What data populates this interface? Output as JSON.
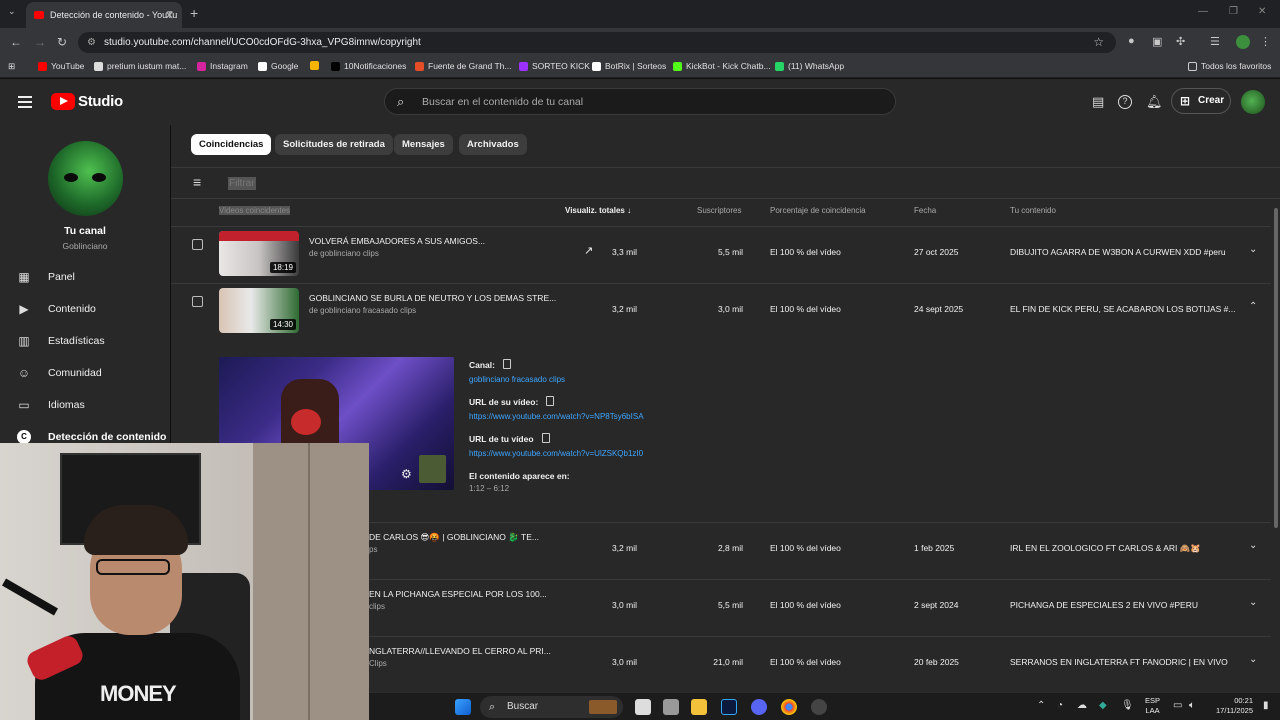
{
  "browser": {
    "tab_title": "Detección de contenido - YouTu",
    "url": "studio.youtube.com/channel/UCO0cdOFdG-3hxa_VPG8imnw/copyright",
    "bookmarks": [
      {
        "label": "YouTube",
        "color": "#ff0000"
      },
      {
        "label": "pretium iustum mat...",
        "color": "#dddddd"
      },
      {
        "label": "Instagram",
        "color": "#d6249f"
      },
      {
        "label": "Google",
        "color": "#ffffff"
      },
      {
        "label": "",
        "color": "#f4b400"
      },
      {
        "label": "10Notificaciones",
        "color": "#000000"
      },
      {
        "label": "Fuente de Grand Th...",
        "color": "#e44d26"
      },
      {
        "label": "SORTEO KICK",
        "color": "#9b30ff"
      },
      {
        "label": "BotRix | Sorteos",
        "color": "#ffffff"
      },
      {
        "label": "KickBot - Kick Chatb...",
        "color": "#53fc18"
      },
      {
        "label": "(11) WhatsApp",
        "color": "#25d366"
      }
    ],
    "all_bookmarks": "Todos los favoritos"
  },
  "header": {
    "logo_text": "Studio",
    "search_placeholder": "Buscar en el contenido de tu canal",
    "create_label": "Crear"
  },
  "sidebar": {
    "channel_title": "Tu canal",
    "channel_name": "Goblinciano",
    "items": [
      {
        "label": "Panel",
        "icon": "dashboard-icon"
      },
      {
        "label": "Contenido",
        "icon": "content-icon"
      },
      {
        "label": "Estadísticas",
        "icon": "analytics-icon"
      },
      {
        "label": "Comunidad",
        "icon": "community-icon"
      },
      {
        "label": "Idiomas",
        "icon": "subtitles-icon"
      },
      {
        "label": "Detección de contenido",
        "icon": "copyright-icon",
        "active": true
      }
    ]
  },
  "tabs": [
    "Coincidencias",
    "Solicitudes de retirada",
    "Mensajes",
    "Archivados"
  ],
  "filter_label": "Filtrar",
  "columns": {
    "videos": "Videos coincidentes",
    "views": "Visualiz. totales",
    "subs": "Suscriptores",
    "match": "Porcentaje de coincidencia",
    "date": "Fecha",
    "yours": "Tu contenido"
  },
  "rows": [
    {
      "title": "VOLVERÁ EMBAJADORES A SUS AMIGOS...",
      "channel": "de goblinciano clips",
      "duration": "18:19",
      "views": "3,3 mil",
      "subs": "5,5 mil",
      "match": "El 100 % del vídeo",
      "date": "27 oct 2025",
      "yours": "DIBUJITO AGARRA DE W3BON A CURWEN XDD #peru",
      "trending": true
    },
    {
      "title": "GOBLINCIANO SE BURLA DE NEUTRO Y LOS DEMAS STRE...",
      "channel": "de goblinciano fracasado clips",
      "duration": "14:30",
      "views": "3,2 mil",
      "subs": "3,0 mil",
      "match": "El 100 % del vídeo",
      "date": "24 sept 2025",
      "yours": "EL FIN DE KICK PERU, SE ACABARON LOS BOTIJAS #...",
      "expanded": true
    },
    {
      "title": "DE CARLOS 😎🤬 | GOBLINCIANO 🐉 TE...",
      "channel": "ps",
      "views": "3,2 mil",
      "subs": "2,8 mil",
      "match": "El 100 % del vídeo",
      "date": "1 feb 2025",
      "yours": "IRL EN EL ZOOLOGICO FT CARLOS & ARI 🙈🐹"
    },
    {
      "title": "EN LA PICHANGA ESPECIAL POR LOS 100...",
      "channel": "clips",
      "views": "3,0 mil",
      "subs": "5,5 mil",
      "match": "El 100 % del vídeo",
      "date": "2 sept 2024",
      "yours": "PICHANGA DE ESPECIALES 2 EN VIVO #PERU"
    },
    {
      "title": "NGLATERRA//LLEVANDO EL CERRO AL PRI...",
      "channel": "Clips",
      "views": "3,0 mil",
      "subs": "21,0 mil",
      "match": "El 100 % del vídeo",
      "date": "20 feb 2025",
      "yours": "SERRANOS EN INGLATERRA FT FANODRIC | EN VIVO"
    }
  ],
  "expanded": {
    "channel_label": "Canal:",
    "channel_value": "goblinciano fracasado clips",
    "their_url_label": "URL de su vídeo:",
    "their_url": "https://www.youtube.com/watch?v=NP8Tsy6bISA",
    "your_url_label": "URL de tu vídeo",
    "your_url": "https://www.youtube.com/watch?v=UlZSKQb1zI0",
    "appears_label": "El contenido aparece en:",
    "appears_value": "1:12 – 6:12"
  },
  "webcam": {
    "shirt_text": "MONEY"
  },
  "taskbar": {
    "search": "Buscar",
    "lang": "ESP",
    "lang2": "LAA",
    "time": "00:21",
    "date": "17/11/2025"
  }
}
